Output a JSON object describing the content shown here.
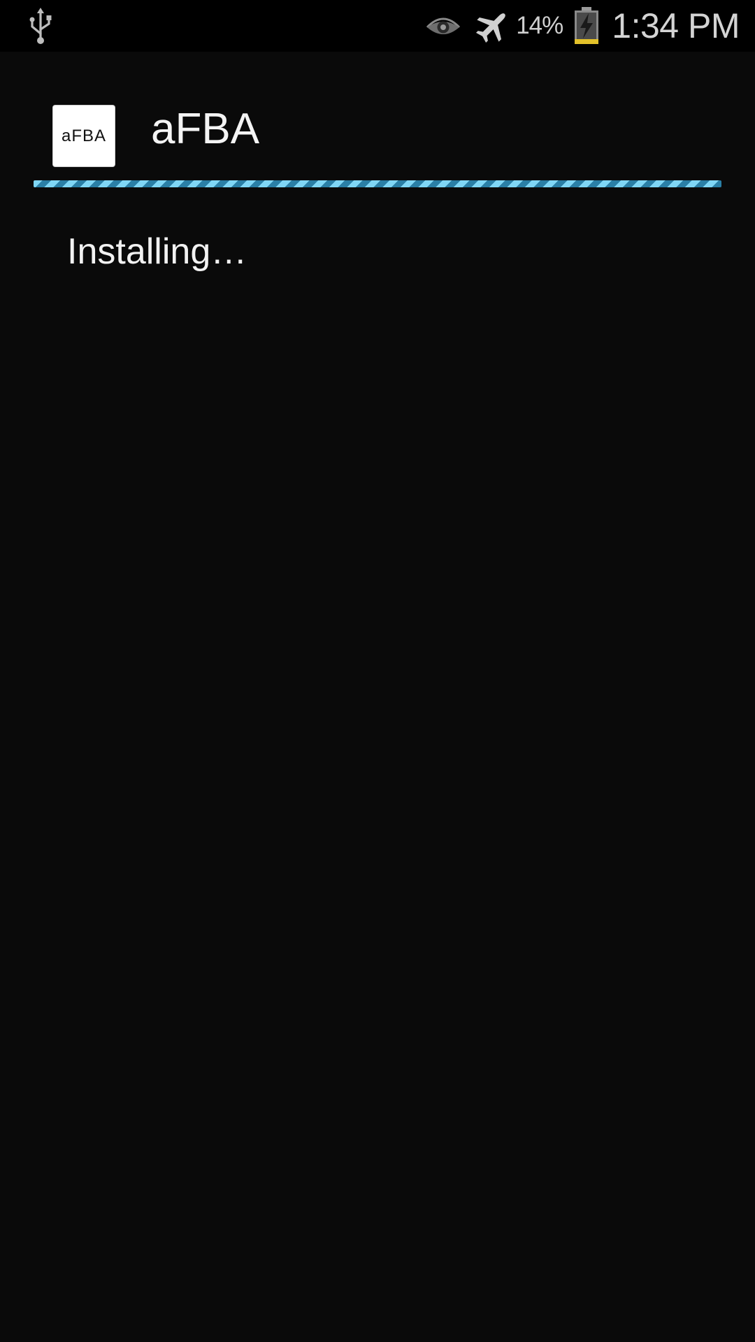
{
  "status_bar": {
    "battery_percent": "14%",
    "time": "1:34 PM",
    "icons": [
      "usb-icon",
      "smart-stay-eye-icon",
      "airplane-mode-icon",
      "battery-charging-icon"
    ]
  },
  "installer": {
    "app_icon_text": "aFBA",
    "app_name": "aFBA",
    "progress": "indeterminate",
    "status_message": "Installing…"
  },
  "colors": {
    "background": "#0a0a0a",
    "progress_light": "#7fd6f5",
    "progress_dark": "#2a7fa6",
    "battery_level": "#e3c12a"
  }
}
